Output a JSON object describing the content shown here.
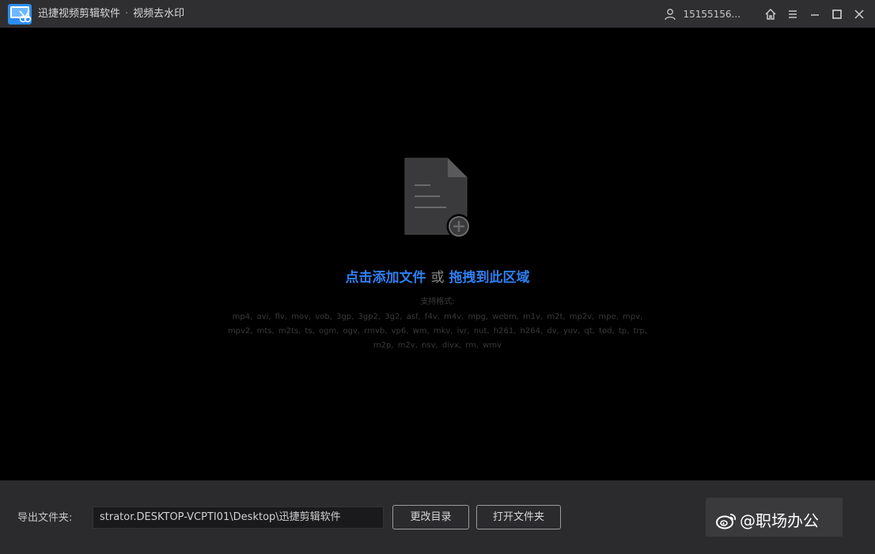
{
  "titlebar": {
    "app_name": "迅捷视频剪辑软件",
    "separator": "·",
    "module_name": "视频去水印",
    "user_name": "15155156..."
  },
  "dropzone": {
    "add_file_link": "点击添加文件",
    "or_text": "或",
    "drag_link": "拖拽到此区域",
    "formats_label": "支持格式:",
    "formats": "mp4, avi, flv, mov, vob, 3gp, 3gp2, 3g2, asf, f4v, m4v, mpg, webm, m1v, m2t, mp2v, mpe, mpv, mpv2, mts, m2ts, ts, ogm, ogv, rmvb, vp6, wm, mkv, ivr, nut, h261, h264, dv, yuv, qt, tod, tp, trp, m2p, m2v, nsv, divx, rm, wmv"
  },
  "bottombar": {
    "export_label": "导出文件夹:",
    "export_path": "strator.DESKTOP-VCPTI01\\Desktop\\迅捷剪辑软件",
    "change_dir_button": "更改目录",
    "open_folder_button": "打开文件夹",
    "watermark_text": "@职场办公"
  },
  "colors": {
    "titlebar_bg": "#2f2f32",
    "content_bg": "#000000",
    "bottombar_bg": "#2b2b2e",
    "link_blue": "#2f7ff2"
  },
  "icons": [
    "app-logo-icon",
    "user-icon",
    "home-icon",
    "menu-icon",
    "minimize-icon",
    "maximize-icon",
    "close-icon",
    "file-add-icon",
    "weibo-icon"
  ]
}
